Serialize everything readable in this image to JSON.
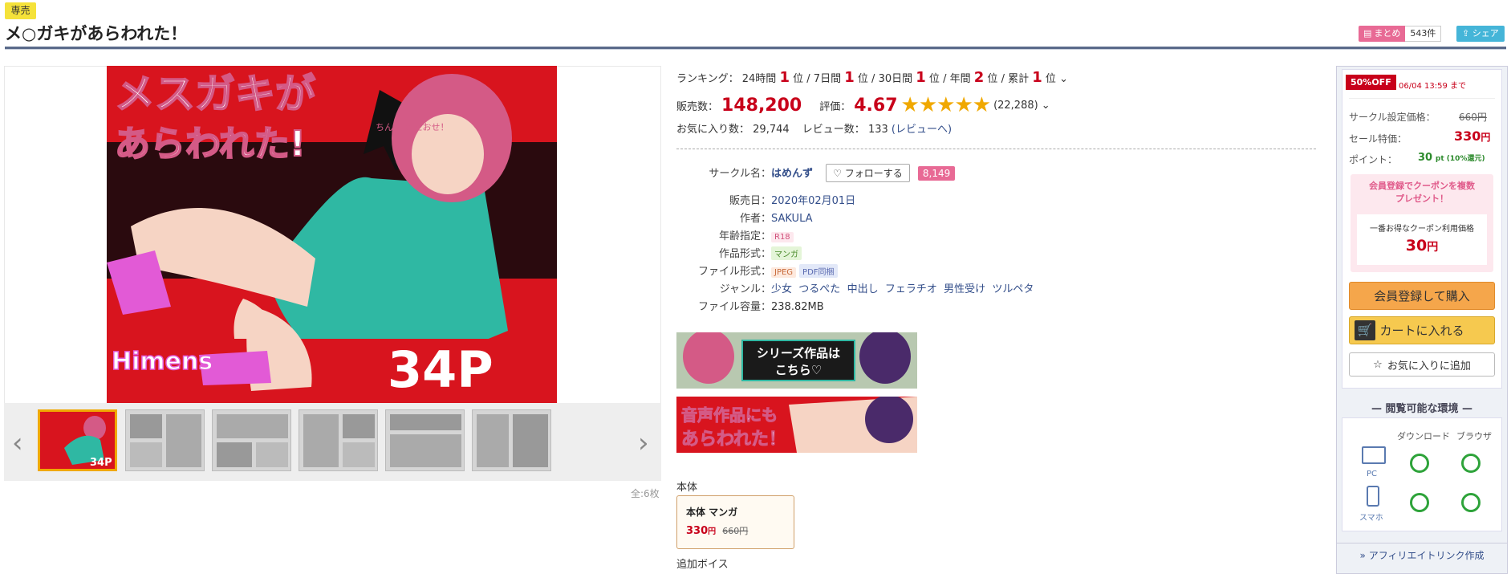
{
  "page": {
    "badge": "専売",
    "title": "メ○ガキがあらわれた！",
    "matome_label": "まとめ",
    "matome_count": "543件",
    "share_label": "シェア"
  },
  "gallery": {
    "main_title_line1": "メスガキが",
    "main_title_line2": "あらわれた!",
    "main_arrow_text": "ちんこで\nたおせ！",
    "main_pages": "34P",
    "main_circle_logo": "Himens",
    "thumb_pages": "34P",
    "count": "全:6枚",
    "prev_icon": "‹",
    "next_icon": "›"
  },
  "ranking": {
    "label": "ランキング：",
    "items": [
      {
        "period": "24時間",
        "rank": "1",
        "unit": "位"
      },
      {
        "period": "7日間",
        "rank": "1",
        "unit": "位"
      },
      {
        "period": "30日間",
        "rank": "1",
        "unit": "位"
      },
      {
        "period": "年間",
        "rank": "2",
        "unit": "位"
      },
      {
        "period": "累計",
        "rank": "1",
        "unit": "位"
      }
    ]
  },
  "sales": {
    "label": "販売数：",
    "value": "148,200",
    "rating_label": "評価：",
    "rating": "4.67",
    "stars": 4.67,
    "rating_count": "(22,288)"
  },
  "favorites": {
    "label": "お気に入り数：",
    "value": "29,744",
    "review_label": "レビュー数：",
    "review_value": "133",
    "review_link": "(レビューへ)"
  },
  "details": {
    "circle_label": "サークル名：",
    "circle": "はめんず",
    "follow": "フォローする",
    "follow_count": "8,149",
    "release_label": "販売日：",
    "release": "2020年02月01日",
    "author_label": "作者：",
    "author": "SAKULA",
    "age_label": "年齢指定：",
    "age": "R18",
    "format_label": "作品形式：",
    "format": "マンガ",
    "file_label": "ファイル形式：",
    "file_tags": [
      "JPEG",
      "PDF同梱"
    ],
    "genre_label": "ジャンル：",
    "genres": [
      "少女",
      "つるぺた",
      "中出し",
      "フェラチオ",
      "男性受け",
      "ツルペタ"
    ],
    "size_label": "ファイル容量：",
    "size": "238.82MB"
  },
  "banners": {
    "series": "シリーズ作品は\nこちら♡",
    "voice": "音声作品にも\nあらわれた！"
  },
  "edition": {
    "section": "本体",
    "name": "本体 マンガ",
    "price": "330",
    "price_unit": "円",
    "orig_price": "660円",
    "extra_section": "追加ボイス"
  },
  "sidebar": {
    "discount": "50%OFF",
    "deadline": "06/04 13:59 まで",
    "set_price_label": "サークル設定価格：",
    "set_price": "660円",
    "sale_label": "セール特価：",
    "sale_price": "330",
    "sale_unit": "円",
    "point_label": "ポイント：",
    "points": "30",
    "point_rate": "pt (10%還元)",
    "coupon_head": "会員登録でクーポンを複数\nプレゼント！",
    "coupon_label": "一番お得なクーポン利用価格",
    "coupon_price": "30",
    "coupon_unit": "円",
    "buy": "会員登録して購入",
    "cart": "カートに入れる",
    "fav": "お気に入りに追加",
    "env_title": "閲覧可能な環境",
    "download": "ダウンロード",
    "browser": "ブラウザ",
    "pc": "PC",
    "phone": "スマホ",
    "affiliate": "アフィリエイトリンク作成"
  },
  "colors": {
    "accent_red": "#c8001a",
    "star": "#f0a800",
    "pink": "#e86a95",
    "buy": "#f5a64b"
  }
}
